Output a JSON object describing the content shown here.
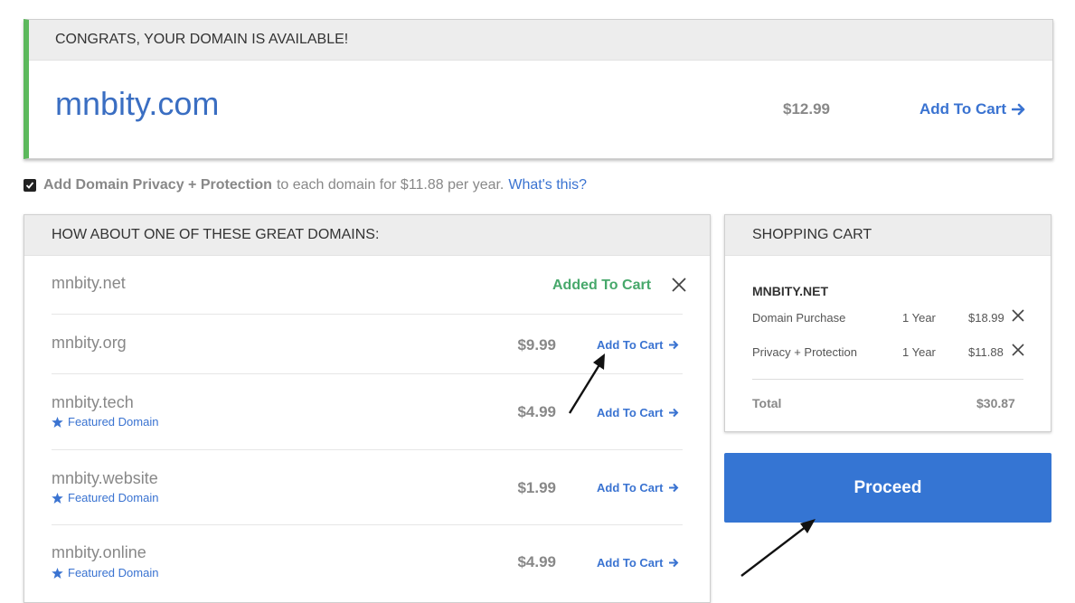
{
  "available": {
    "header": "CONGRATS, YOUR DOMAIN IS AVAILABLE!",
    "domain": "mnbity.com",
    "price": "$12.99",
    "add_label": "Add To Cart",
    "accent_color": "#5cb85c"
  },
  "privacy": {
    "checked": true,
    "strong_text": "Add Domain Privacy + Protection",
    "rest_text": "to each domain for $11.88 per year.",
    "link_text": "What's this?"
  },
  "suggestions": {
    "header": "HOW ABOUT ONE OF THESE GREAT DOMAINS:",
    "featured_label": "Featured Domain",
    "items": [
      {
        "name": "mnbity.net",
        "status": "Added To Cart",
        "featured": false
      },
      {
        "name": "mnbity.org",
        "price": "$9.99",
        "add_label": "Add To Cart",
        "featured": false
      },
      {
        "name": "mnbity.tech",
        "price": "$4.99",
        "add_label": "Add To Cart",
        "featured": true
      },
      {
        "name": "mnbity.website",
        "price": "$1.99",
        "add_label": "Add To Cart",
        "featured": true
      },
      {
        "name": "mnbity.online",
        "price": "$4.99",
        "add_label": "Add To Cart",
        "featured": true
      }
    ]
  },
  "cart": {
    "header": "SHOPPING CART",
    "item_title": "MNBITY.NET",
    "lines": [
      {
        "label": "Domain Purchase",
        "term": "1 Year",
        "amount": "$18.99"
      },
      {
        "label": "Privacy + Protection",
        "term": "1 Year",
        "amount": "$11.88"
      }
    ],
    "total_label": "Total",
    "total_amount": "$30.87"
  },
  "proceed_label": "Proceed",
  "colors": {
    "link_blue": "#3a73d1",
    "button_blue": "#3575d3",
    "added_green": "#47a86b"
  }
}
